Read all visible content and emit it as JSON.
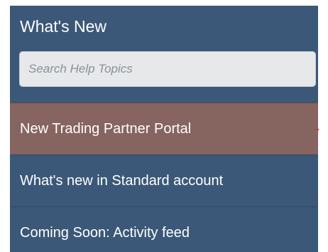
{
  "header": {
    "title": "What's New"
  },
  "search": {
    "placeholder": "Search Help Topics",
    "value": ""
  },
  "menu": {
    "items": [
      {
        "label": "New Trading Partner Portal",
        "active": true
      },
      {
        "label": "What's new in Standard account",
        "active": false
      },
      {
        "label": "Coming Soon: Activity feed",
        "active": false
      }
    ]
  },
  "colors": {
    "panel_background": "#3b5878",
    "active_item_background": "#866560",
    "search_background": "#e6e8ea",
    "text": "#ffffff",
    "active_marker": "#c83a2a"
  }
}
